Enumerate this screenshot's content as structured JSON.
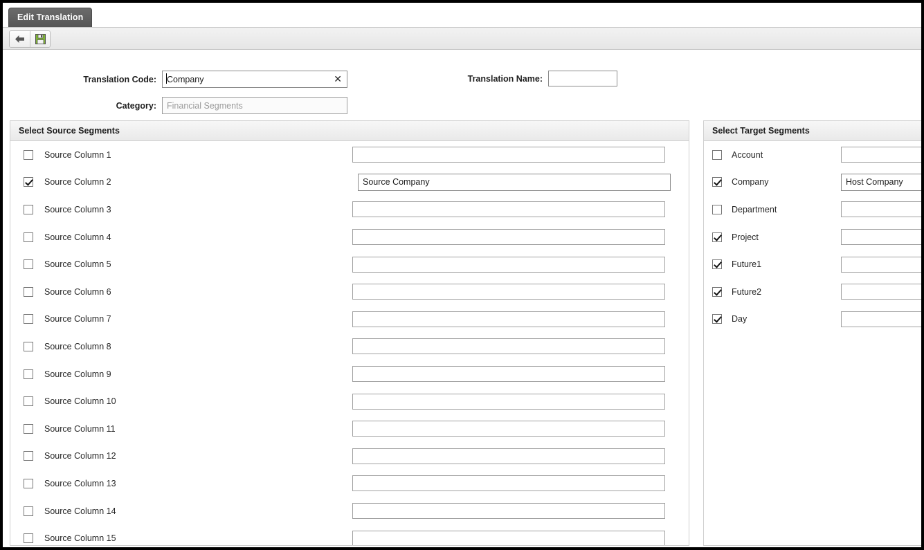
{
  "tab": {
    "label": "Edit Translation"
  },
  "toolbar": {
    "back_label": "back-arrow",
    "save_label": "save-floppy"
  },
  "form": {
    "translation_code": {
      "label": "Translation Code:",
      "value": "Company",
      "clear_glyph": "✕"
    },
    "translation_name": {
      "label": "Translation Name:",
      "value": "",
      "placeholder": ""
    },
    "category": {
      "label": "Category:",
      "value": "Financial Segments",
      "disabled": true
    }
  },
  "source_panel": {
    "title": "Select Source Segments",
    "rows": [
      {
        "label": "Source Column 1",
        "checked": false,
        "value": ""
      },
      {
        "label": "Source Column 2",
        "checked": true,
        "value": "Source Company"
      },
      {
        "label": "Source Column 3",
        "checked": false,
        "value": ""
      },
      {
        "label": "Source Column 4",
        "checked": false,
        "value": ""
      },
      {
        "label": "Source Column 5",
        "checked": false,
        "value": ""
      },
      {
        "label": "Source Column 6",
        "checked": false,
        "value": ""
      },
      {
        "label": "Source Column 7",
        "checked": false,
        "value": ""
      },
      {
        "label": "Source Column 8",
        "checked": false,
        "value": ""
      },
      {
        "label": "Source Column 9",
        "checked": false,
        "value": ""
      },
      {
        "label": "Source Column 10",
        "checked": false,
        "value": ""
      },
      {
        "label": "Source Column 11",
        "checked": false,
        "value": ""
      },
      {
        "label": "Source Column 12",
        "checked": false,
        "value": ""
      },
      {
        "label": "Source Column 13",
        "checked": false,
        "value": ""
      },
      {
        "label": "Source Column 14",
        "checked": false,
        "value": ""
      },
      {
        "label": "Source Column 15",
        "checked": false,
        "value": ""
      }
    ]
  },
  "target_panel": {
    "title": "Select Target Segments",
    "rows": [
      {
        "label": "Account",
        "checked": false,
        "value": ""
      },
      {
        "label": "Company",
        "checked": true,
        "value": "Host Company"
      },
      {
        "label": "Department",
        "checked": false,
        "value": ""
      },
      {
        "label": "Project",
        "checked": true,
        "value": ""
      },
      {
        "label": "Future1",
        "checked": true,
        "value": ""
      },
      {
        "label": "Future2",
        "checked": true,
        "value": ""
      },
      {
        "label": "Day",
        "checked": true,
        "value": ""
      }
    ]
  },
  "colors": {
    "tab_bg": "#5a5a5a",
    "panel_border": "#cfcfcf",
    "save_icon_green": "#8cc63e",
    "frame_border": "#000000"
  }
}
